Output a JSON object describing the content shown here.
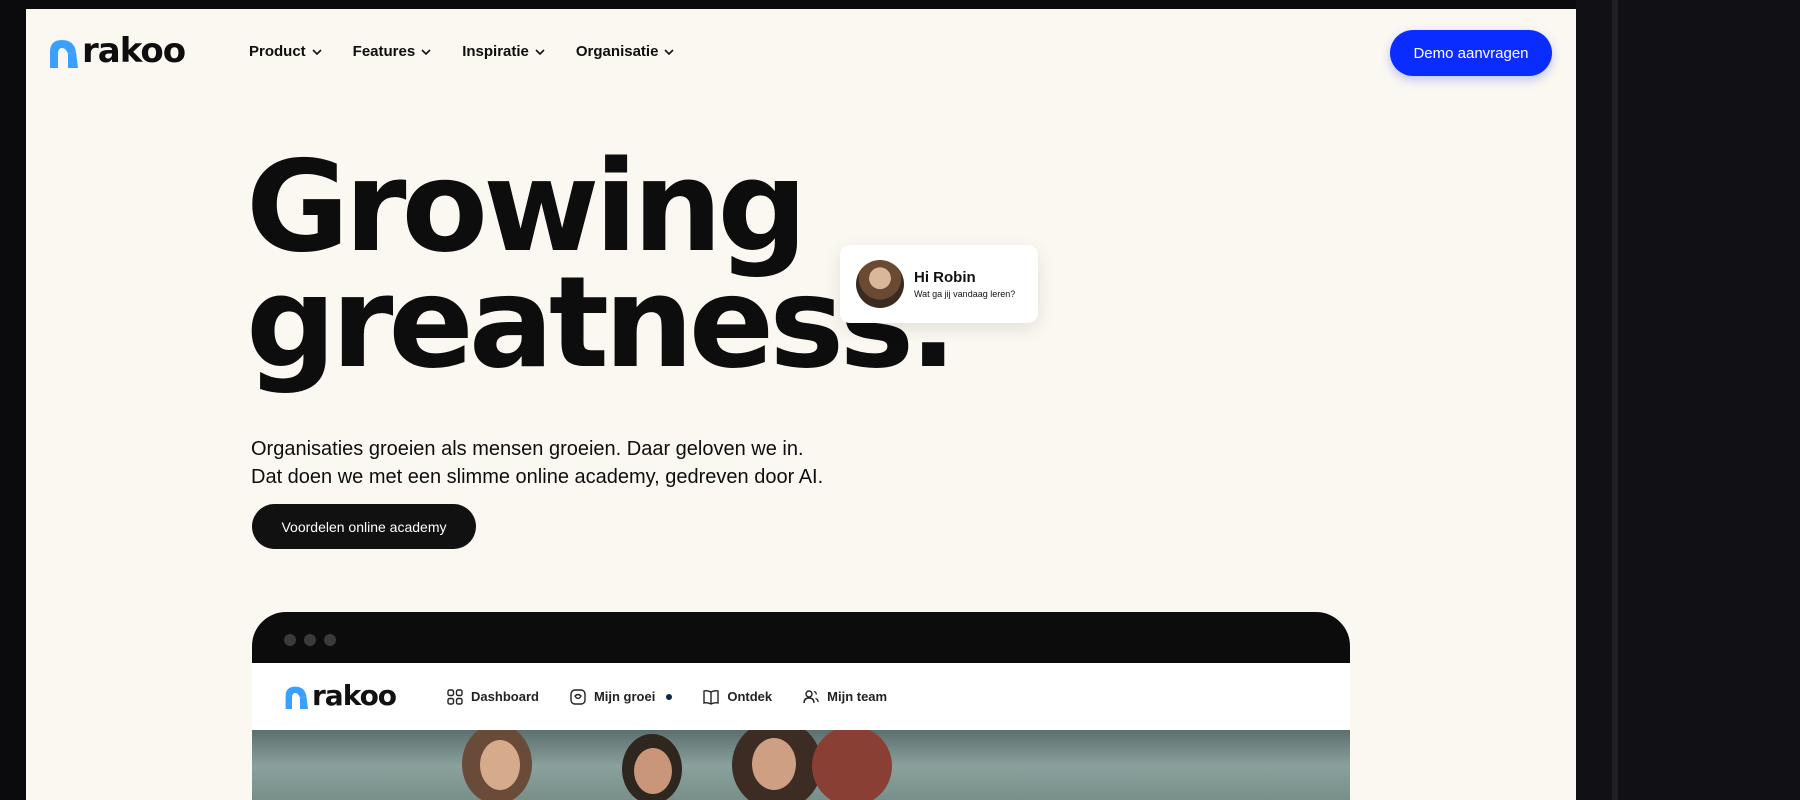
{
  "logo": {
    "text": "rakoo",
    "icon": "rakoo-logo-icon"
  },
  "nav": {
    "items": [
      {
        "label": "Product"
      },
      {
        "label": "Features"
      },
      {
        "label": "Inspiratie"
      },
      {
        "label": "Organisatie"
      }
    ]
  },
  "header": {
    "demo_button": "Demo aanvragen"
  },
  "hero": {
    "title_line1": "Growing",
    "title_line2": "greatness.",
    "text_line1": "Organisaties groeien als mensen groeien. Daar geloven we in.",
    "text_line2": "Dat doen we met een slimme online academy, gedreven door AI.",
    "cta": "Voordelen online academy"
  },
  "greeting": {
    "name": "Hi Robin",
    "subtitle": "Wat ga jij vandaag leren?"
  },
  "app_preview": {
    "logo_text": "rakoo",
    "nav": [
      {
        "label": "Dashboard",
        "icon": "grid-icon"
      },
      {
        "label": "Mijn groei",
        "icon": "badge-icon"
      },
      {
        "label": "Ontdek",
        "icon": "book-icon"
      },
      {
        "label": "Mijn team",
        "icon": "team-icon"
      }
    ]
  },
  "colors": {
    "accent": "#0a2cff",
    "logo_blue": "#3aa0ff",
    "background": "#fbf8f1",
    "dark": "#111111"
  }
}
